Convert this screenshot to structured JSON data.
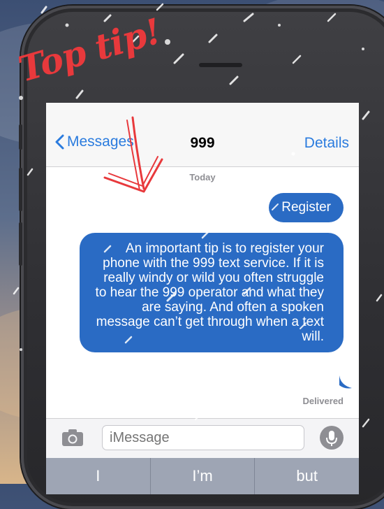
{
  "annotation": {
    "text": "Top tip!"
  },
  "nav": {
    "back_label": "Messages",
    "title": "999",
    "details_label": "Details"
  },
  "conversation": {
    "date": "Today",
    "messages": [
      {
        "text": "Register"
      },
      {
        "text": "An important tip is to register your phone with the 999 text service. If it is really windy or wild you often struggle to hear the 999 operator and what they are saying. And often a spoken message can’t get through when a text will."
      }
    ],
    "status": "Delivered"
  },
  "composer": {
    "placeholder": "iMessage"
  },
  "suggestions": [
    "I",
    "I’m",
    "but"
  ],
  "colors": {
    "accent": "#2a7bde",
    "bubble": "#2a6bc4",
    "annotation": "#e8393c"
  },
  "icons": [
    "chevron-left-icon",
    "camera-icon",
    "microphone-icon"
  ]
}
